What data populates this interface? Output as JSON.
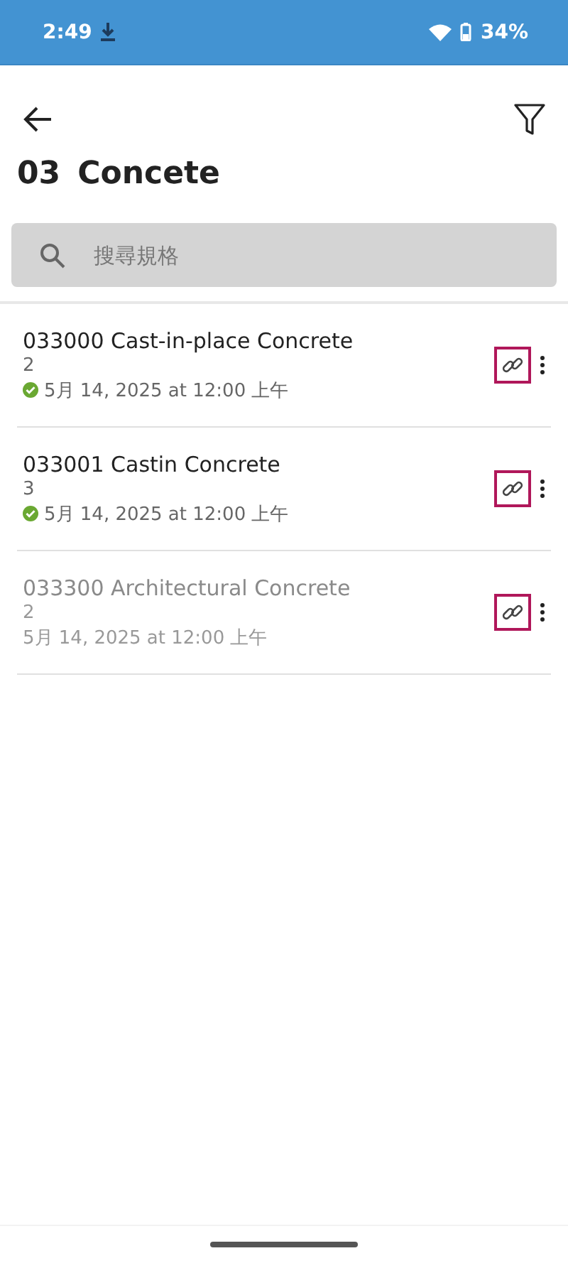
{
  "status_bar": {
    "time": "2:49",
    "battery": "34%"
  },
  "header": {
    "title_code": "03",
    "title_name": "Concete"
  },
  "search": {
    "placeholder": "搜尋規格"
  },
  "items": [
    {
      "title": "033000 Cast-in-place Concrete",
      "revision": "2",
      "date": "5月 14, 2025 at 12:00 上午",
      "synced": true,
      "disabled": false
    },
    {
      "title": "033001 Castin Concrete",
      "revision": "3",
      "date": "5月 14, 2025 at 12:00 上午",
      "synced": true,
      "disabled": false
    },
    {
      "title": "033300 Architectural Concrete",
      "revision": "2",
      "date": "5月 14, 2025 at 12:00 上午",
      "synced": false,
      "disabled": true
    }
  ]
}
